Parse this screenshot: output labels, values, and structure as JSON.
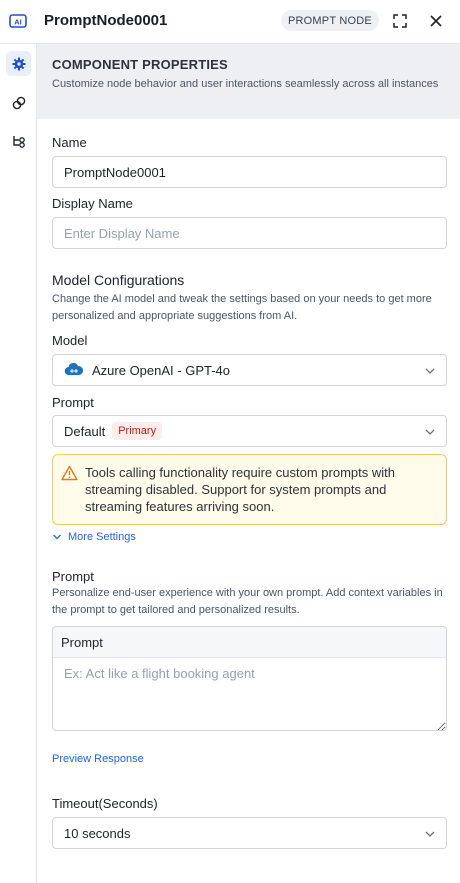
{
  "header": {
    "title": "PromptNode0001",
    "type_badge": "PROMPT NODE",
    "logo_text": "AI"
  },
  "rail": {
    "items": [
      "gear-icon",
      "link-icon",
      "flow-icon"
    ]
  },
  "banner": {
    "title": "COMPONENT PROPERTIES",
    "description": "Customize node behavior and user interactions seamlessly across all instances"
  },
  "form": {
    "name_label": "Name",
    "name_value": "PromptNode0001",
    "display_name_label": "Display Name",
    "display_name_placeholder": "Enter Display Name",
    "model_config_title": "Model Configurations",
    "model_config_desc": "Change the AI model and tweak the settings based on your needs to get more personalized and appropriate suggestions from AI.",
    "model_label": "Model",
    "model_value": "Azure OpenAI - GPT-4o",
    "prompt_label": "Prompt",
    "prompt_value": "Default",
    "prompt_badge": "Primary",
    "warning_text": "Tools calling functionality require custom prompts with streaming disabled. Support for system prompts and streaming features arriving soon.",
    "more_settings": "More Settings",
    "custom_prompt_title": "Prompt",
    "custom_prompt_desc": "Personalize end-user experience with your own prompt. Add context variables in the prompt to get tailored and personalized results.",
    "prompt_box_header": "Prompt",
    "prompt_box_placeholder": "Ex: Act like a flight booking agent",
    "preview_response": "Preview Response",
    "timeout_label": "Timeout(Seconds)",
    "timeout_value": "10 seconds"
  },
  "colors": {
    "accent": "#2563eb",
    "warning_border": "#f3c969",
    "warning_bg": "#fffbeb",
    "badge_red": "#b42318"
  }
}
